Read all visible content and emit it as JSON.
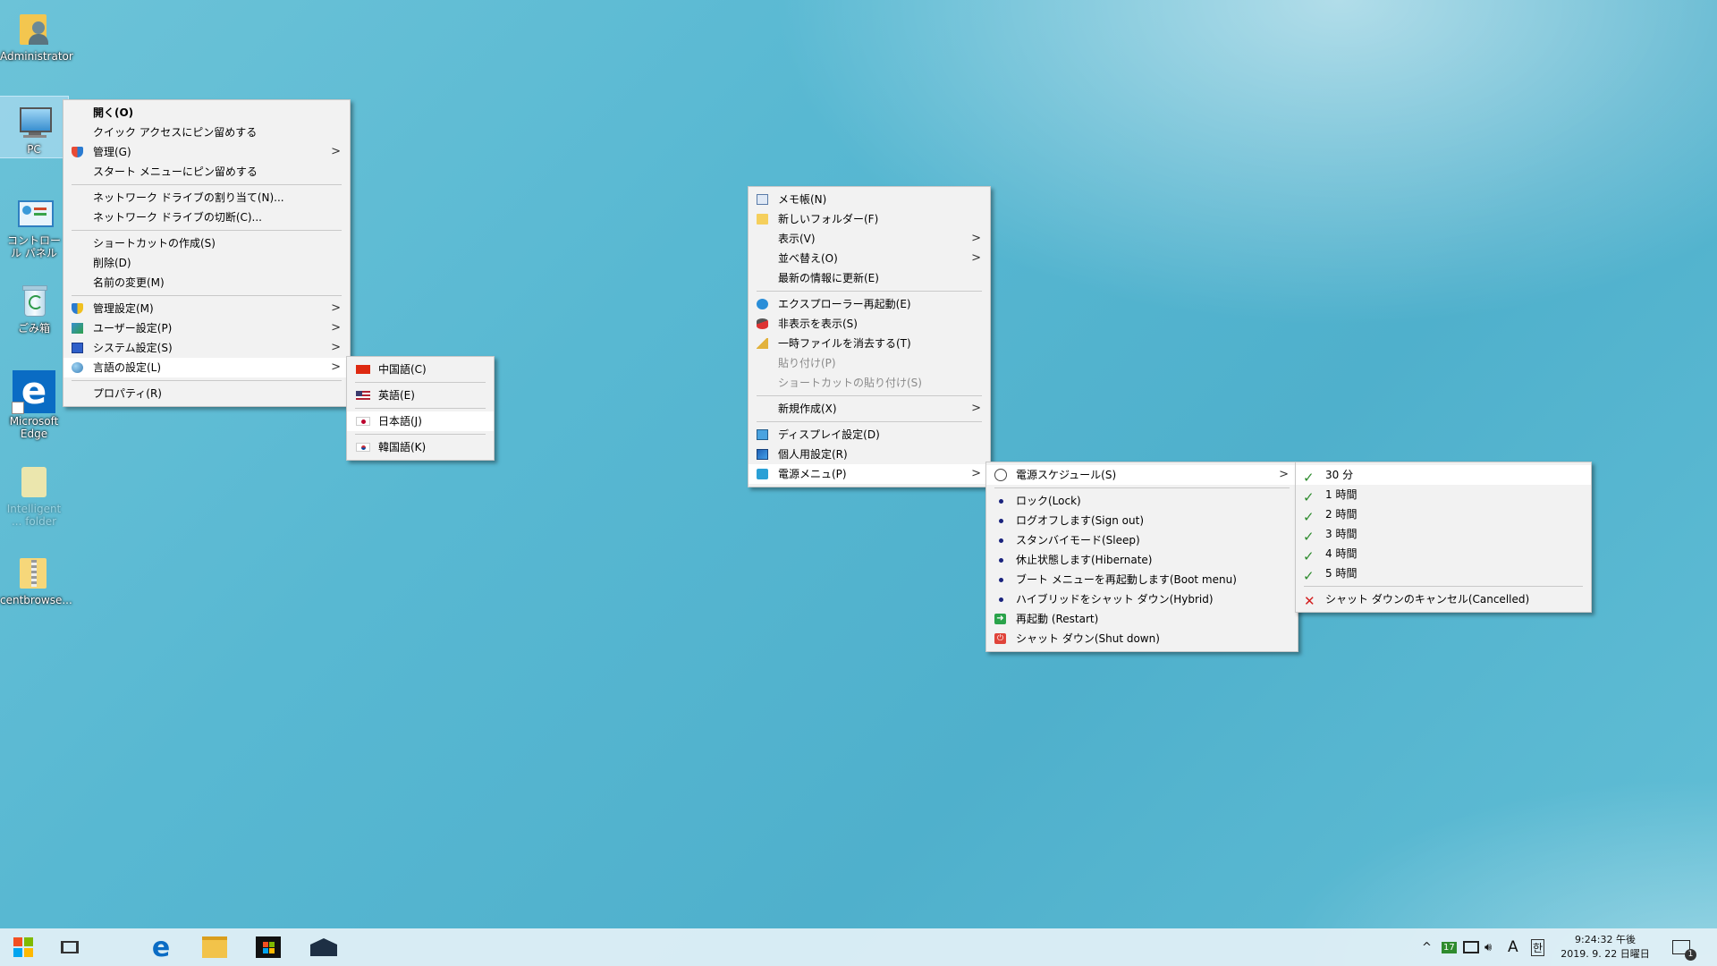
{
  "desktop": {
    "icons": [
      {
        "label": "Administrator"
      },
      {
        "label": "PC"
      },
      {
        "label": "コントロール パネル"
      },
      {
        "label": "ごみ箱"
      },
      {
        "label": "Microsoft Edge"
      },
      {
        "label": "Intelligent ... folder"
      },
      {
        "label": "centbrowse..."
      }
    ]
  },
  "pc_menu": {
    "items": [
      {
        "label": "開く(O)"
      },
      {
        "label": "クイック アクセスにピン留めする"
      },
      {
        "label": "管理(G)"
      },
      {
        "label": "スタート メニューにピン留めする"
      },
      {
        "label": "ネットワーク ドライブの割り当て(N)..."
      },
      {
        "label": "ネットワーク ドライブの切断(C)..."
      },
      {
        "label": "ショートカットの作成(S)"
      },
      {
        "label": "削除(D)"
      },
      {
        "label": "名前の変更(M)"
      },
      {
        "label": "管理設定(M)"
      },
      {
        "label": "ユーザー設定(P)"
      },
      {
        "label": "システム設定(S)"
      },
      {
        "label": "言語の設定(L)"
      },
      {
        "label": "プロパティ(R)"
      }
    ]
  },
  "lang_menu": {
    "items": [
      {
        "label": "中国語(C)"
      },
      {
        "label": "英語(E)"
      },
      {
        "label": "日本語(J)"
      },
      {
        "label": "韓国語(K)"
      }
    ]
  },
  "desk_menu": {
    "items": [
      {
        "label": "メモ帳(N)"
      },
      {
        "label": "新しいフォルダー(F)"
      },
      {
        "label": "表示(V)"
      },
      {
        "label": "並べ替え(O)"
      },
      {
        "label": "最新の情報に更新(E)"
      },
      {
        "label": "エクスプローラー再起動(E)"
      },
      {
        "label": "非表示を表示(S)"
      },
      {
        "label": "一時ファイルを消去する(T)"
      },
      {
        "label": "貼り付け(P)"
      },
      {
        "label": "ショートカットの貼り付け(S)"
      },
      {
        "label": "新規作成(X)"
      },
      {
        "label": "ディスプレイ設定(D)"
      },
      {
        "label": "個人用設定(R)"
      },
      {
        "label": "電源メニュ(P)"
      }
    ]
  },
  "power_menu": {
    "items": [
      {
        "label": "電源スケジュール(S)"
      },
      {
        "label": "ロック(Lock)"
      },
      {
        "label": "ログオフします(Sign out)"
      },
      {
        "label": "スタンバイモード(Sleep)"
      },
      {
        "label": "休止状態します(Hibernate)"
      },
      {
        "label": "ブート メニューを再起動します(Boot menu)"
      },
      {
        "label": "ハイブリッドをシャット ダウン(Hybrid)"
      },
      {
        "label": "再起動 (Restart)"
      },
      {
        "label": "シャット ダウン(Shut down)"
      }
    ]
  },
  "schedule_menu": {
    "items": [
      {
        "label": "30 分"
      },
      {
        "label": "1 時間"
      },
      {
        "label": "2 時間"
      },
      {
        "label": "3 時間"
      },
      {
        "label": "4 時間"
      },
      {
        "label": "5 時間"
      },
      {
        "label": "シャット ダウンのキャンセル(Cancelled)"
      }
    ]
  },
  "taskbar": {
    "tray": {
      "badge": "17",
      "ime": "A",
      "ime2": "한",
      "time": "9:24:32  午後",
      "date": "2019. 9. 22  日曜日",
      "notif_count": "1"
    }
  },
  "colors": {
    "menu_bg": "#f2f2f2",
    "menu_highlight": "#ffffff",
    "check_green": "#2e8b2e",
    "cancel_red": "#d32020"
  }
}
